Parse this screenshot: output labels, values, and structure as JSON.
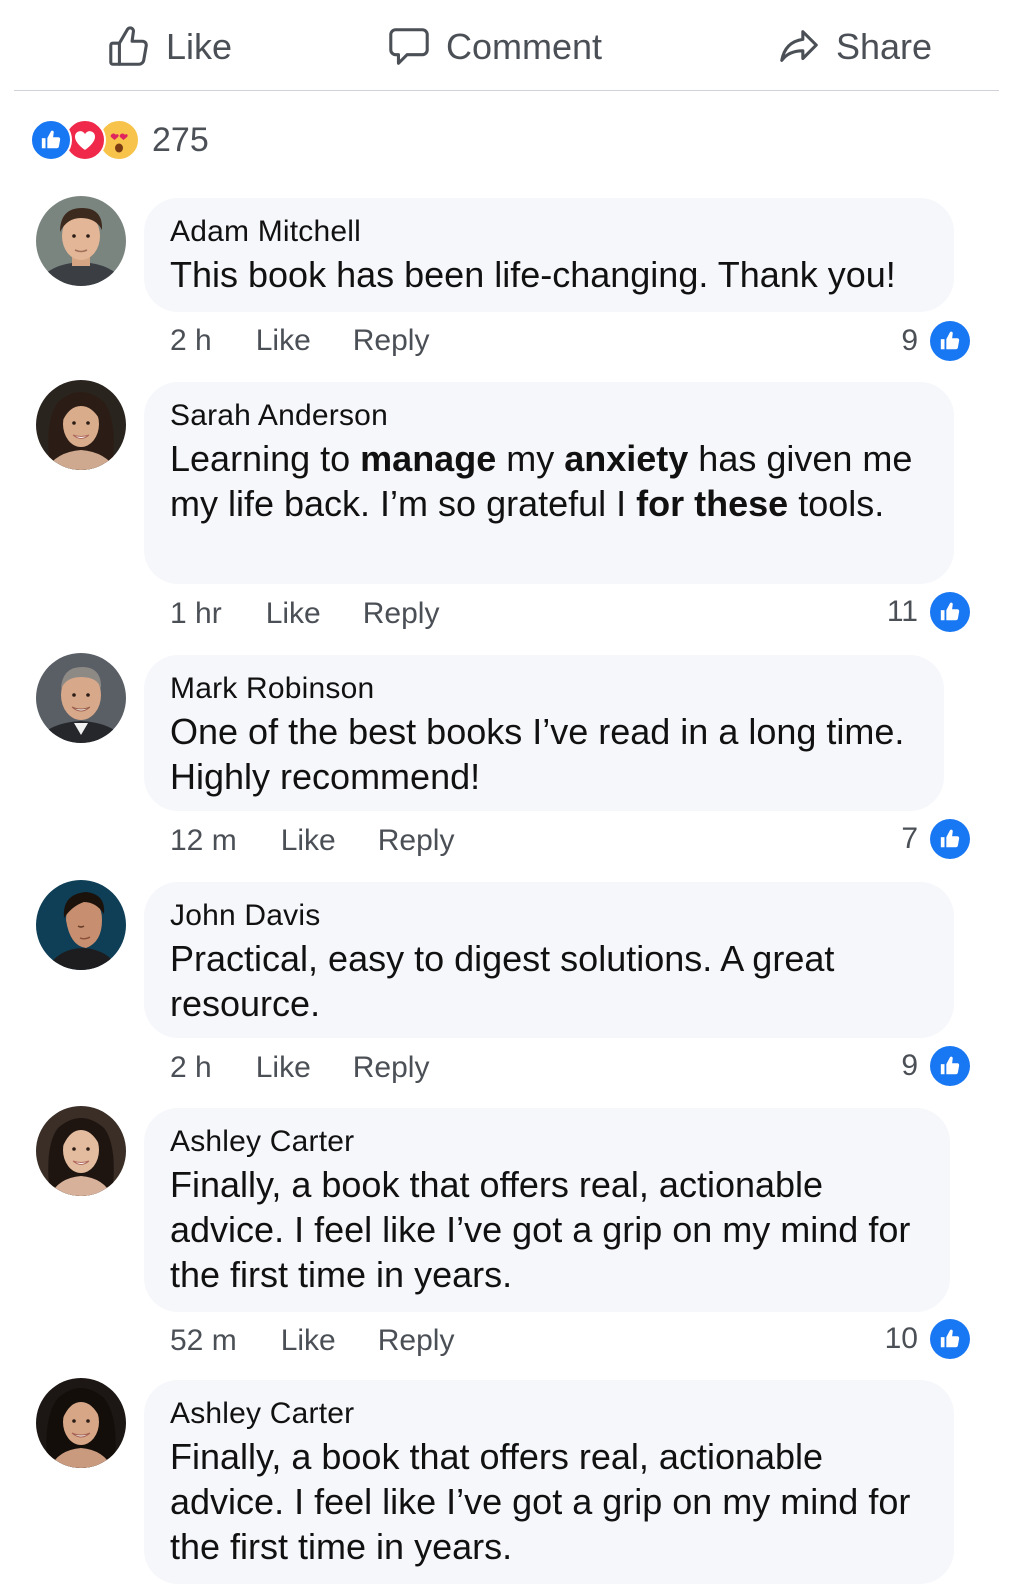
{
  "actions": {
    "like_label": "Like",
    "comment_label": "Comment",
    "share_label": "Share"
  },
  "reactions": {
    "types": [
      "like",
      "love",
      "wow"
    ],
    "count": "275"
  },
  "colors": {
    "accent": "#1877f2",
    "love": "#f02849",
    "wow": "#f7c34a",
    "bubble": "#f6f7fb",
    "muted_text": "#4b4f56"
  },
  "comments": [
    {
      "author": "Adam Mitchell",
      "text": "This book has been life-changing. Thank you!",
      "time": "2 h",
      "like_label": "Like",
      "reply_label": "Reply",
      "likes": "9"
    },
    {
      "author": "Sarah Anderson",
      "text_parts": [
        "Learning to ",
        "manage",
        " my ",
        "anxiety",
        " has given me my life back. I’m so grateful I ",
        "for these",
        " tools."
      ],
      "time": "1 hr",
      "like_label": "Like",
      "reply_label": "Reply",
      "likes": "11"
    },
    {
      "author": "Mark Robinson",
      "text": "One of the best books I’ve read in a long time. Highly recommend!",
      "time": "12 m",
      "like_label": "Like",
      "reply_label": "Reply",
      "likes": "7"
    },
    {
      "author": "John Davis",
      "text": "Practical, easy to digest solutions. A great resource.",
      "time": "2 h",
      "like_label": "Like",
      "reply_label": "Reply",
      "likes": "9"
    },
    {
      "author": "Ashley Carter",
      "text": "Finally, a book that offers real, actionable advice. I feel like I’ve got a grip on my mind for the first time in years.",
      "time": "52 m",
      "like_label": "Like",
      "reply_label": "Reply",
      "likes": "10"
    },
    {
      "author": "Ashley Carter",
      "text": "Finally, a book that offers real, actionable advice. I feel like I’ve got a grip on my mind for the first time in years."
    }
  ]
}
